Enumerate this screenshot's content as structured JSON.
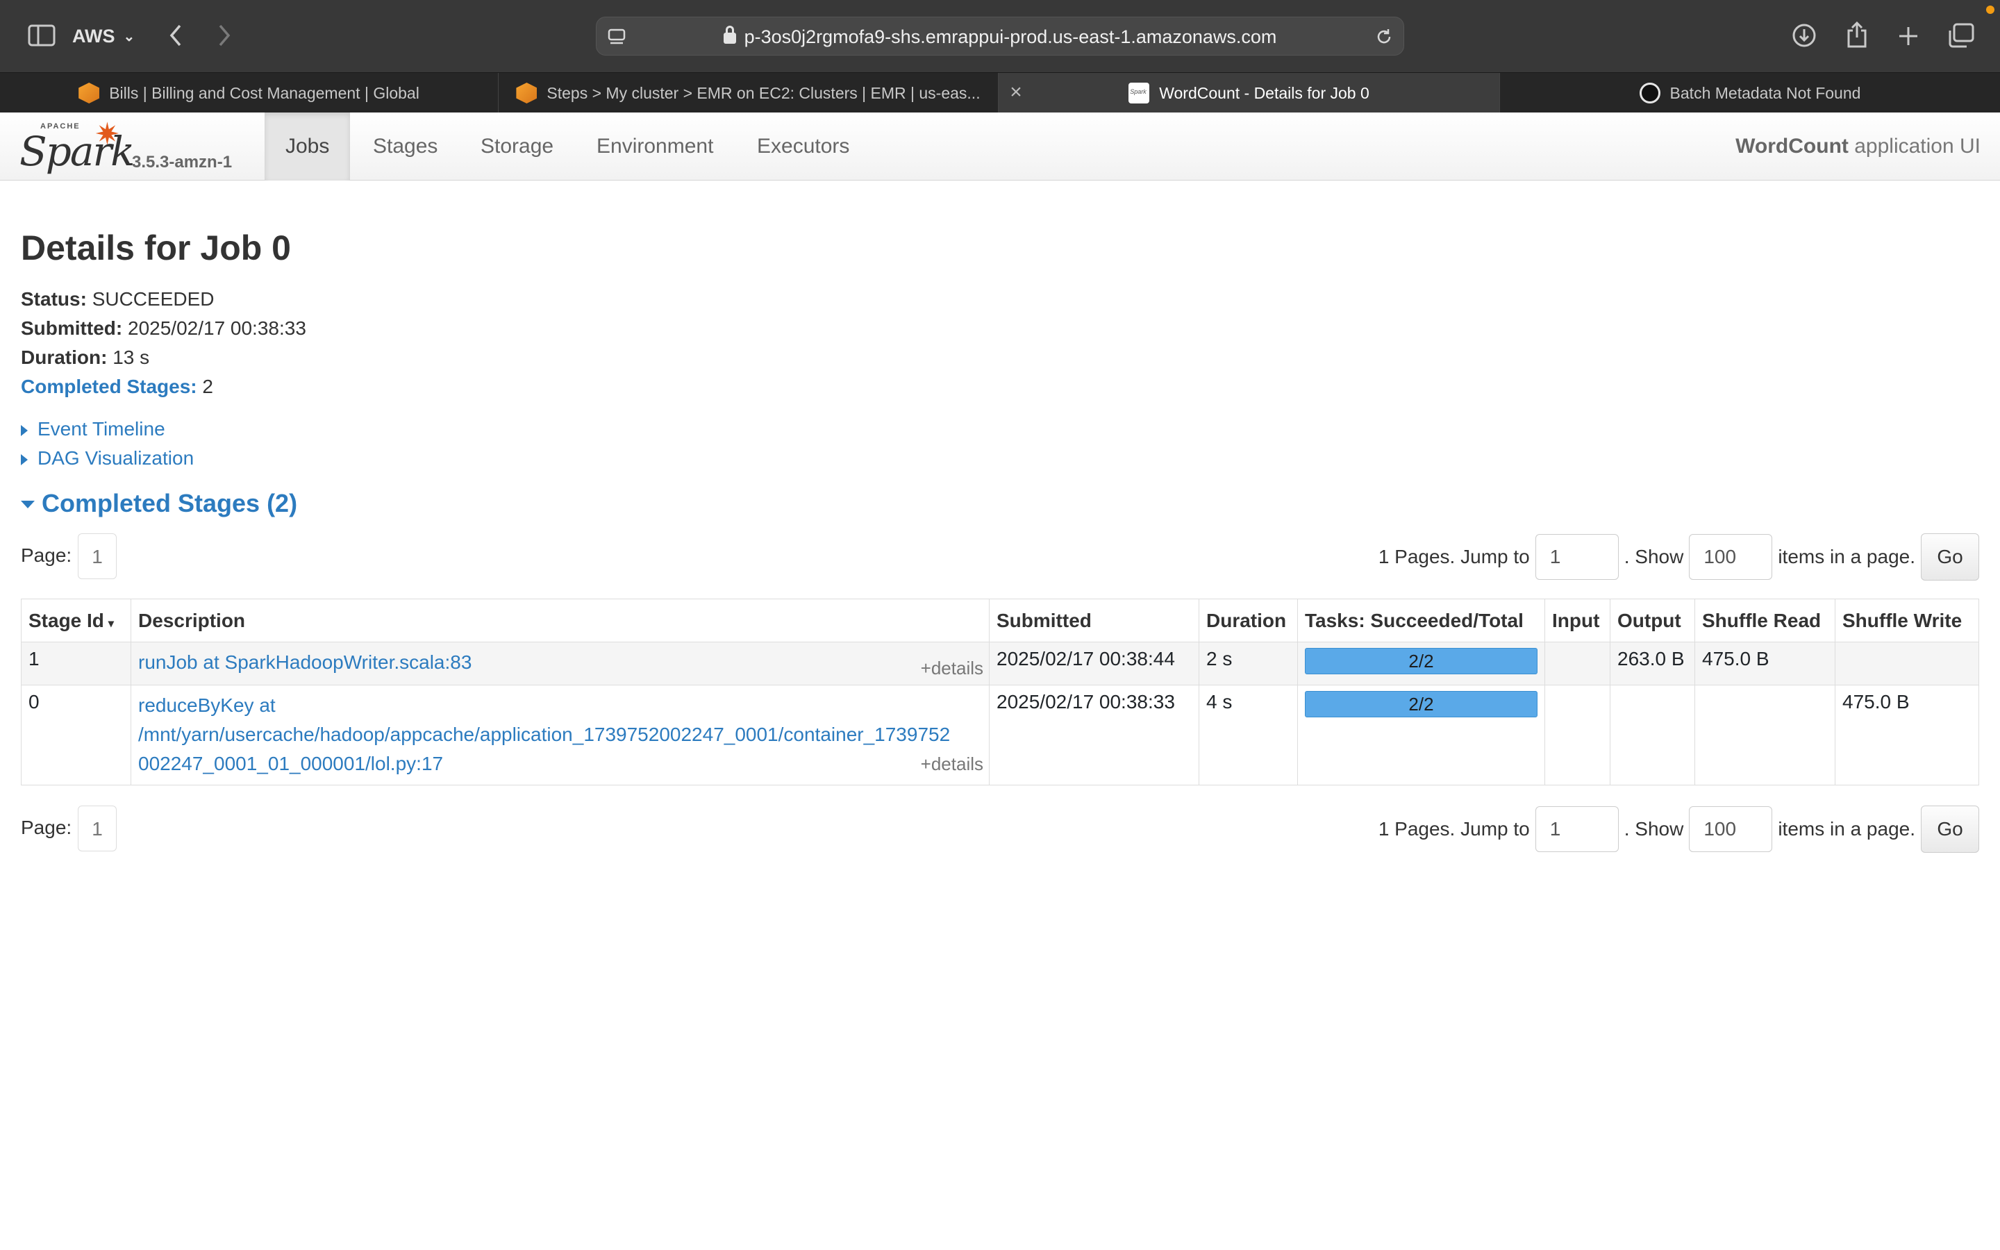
{
  "browser": {
    "profile": "AWS",
    "url": "p-3os0j2rgmofa9-shs.emrappui-prod.us-east-1.amazonaws.com",
    "tabs": [
      {
        "label": "Bills | Billing and Cost Management | Global",
        "icon": "aws-icon"
      },
      {
        "label": "Steps > My cluster > EMR on EC2: Clusters | EMR | us-eas...",
        "icon": "aws-icon"
      },
      {
        "label": "WordCount - Details for Job 0",
        "icon": "spark-icon"
      },
      {
        "label": "Batch Metadata Not Found",
        "icon": "openai-icon"
      }
    ]
  },
  "spark": {
    "logo_top": "APACHE",
    "logo_text": "Spark",
    "version": "3.5.3-amzn-1",
    "nav": [
      "Jobs",
      "Stages",
      "Storage",
      "Environment",
      "Executors"
    ],
    "active_nav": "Jobs",
    "app_name": "WordCount",
    "app_suffix": " application UI"
  },
  "job": {
    "title": "Details for Job 0",
    "status_label": "Status:",
    "status": "SUCCEEDED",
    "submitted_label": "Submitted:",
    "submitted": "2025/02/17 00:38:33",
    "duration_label": "Duration:",
    "duration": "13 s",
    "completed_label": "Completed Stages:",
    "completed_count": "2",
    "event_timeline": "Event Timeline",
    "dag_visualization": "DAG Visualization",
    "section_title": "Completed Stages (2)"
  },
  "pager": {
    "page_label": "Page:",
    "page": "1",
    "pages_text": "1 Pages. Jump to",
    "jump_value": "1",
    "show_text": ". Show",
    "show_value": "100",
    "items_text": "items in a page.",
    "go": "Go"
  },
  "table": {
    "headers": [
      "Stage Id",
      "Description",
      "Submitted",
      "Duration",
      "Tasks: Succeeded/Total",
      "Input",
      "Output",
      "Shuffle Read",
      "Shuffle Write"
    ],
    "details_label": "+details",
    "rows": [
      {
        "id": "1",
        "description": "runJob at SparkHadoopWriter.scala:83",
        "submitted": "2025/02/17 00:38:44",
        "duration": "2 s",
        "tasks": "2/2",
        "tasks_fraction": 1.0,
        "input": "",
        "output": "263.0 B",
        "shuffle_read": "475.0 B",
        "shuffle_write": ""
      },
      {
        "id": "0",
        "description_line1": "reduceByKey at",
        "description_line2": "/mnt/yarn/usercache/hadoop/appcache/application_1739752002247_0001/container_1739752",
        "description_line3": "002247_0001_01_000001/lol.py:17",
        "submitted": "2025/02/17 00:38:33",
        "duration": "4 s",
        "tasks": "2/2",
        "tasks_fraction": 1.0,
        "input": "",
        "output": "",
        "shuffle_read": "",
        "shuffle_write": "475.0 B"
      }
    ]
  }
}
